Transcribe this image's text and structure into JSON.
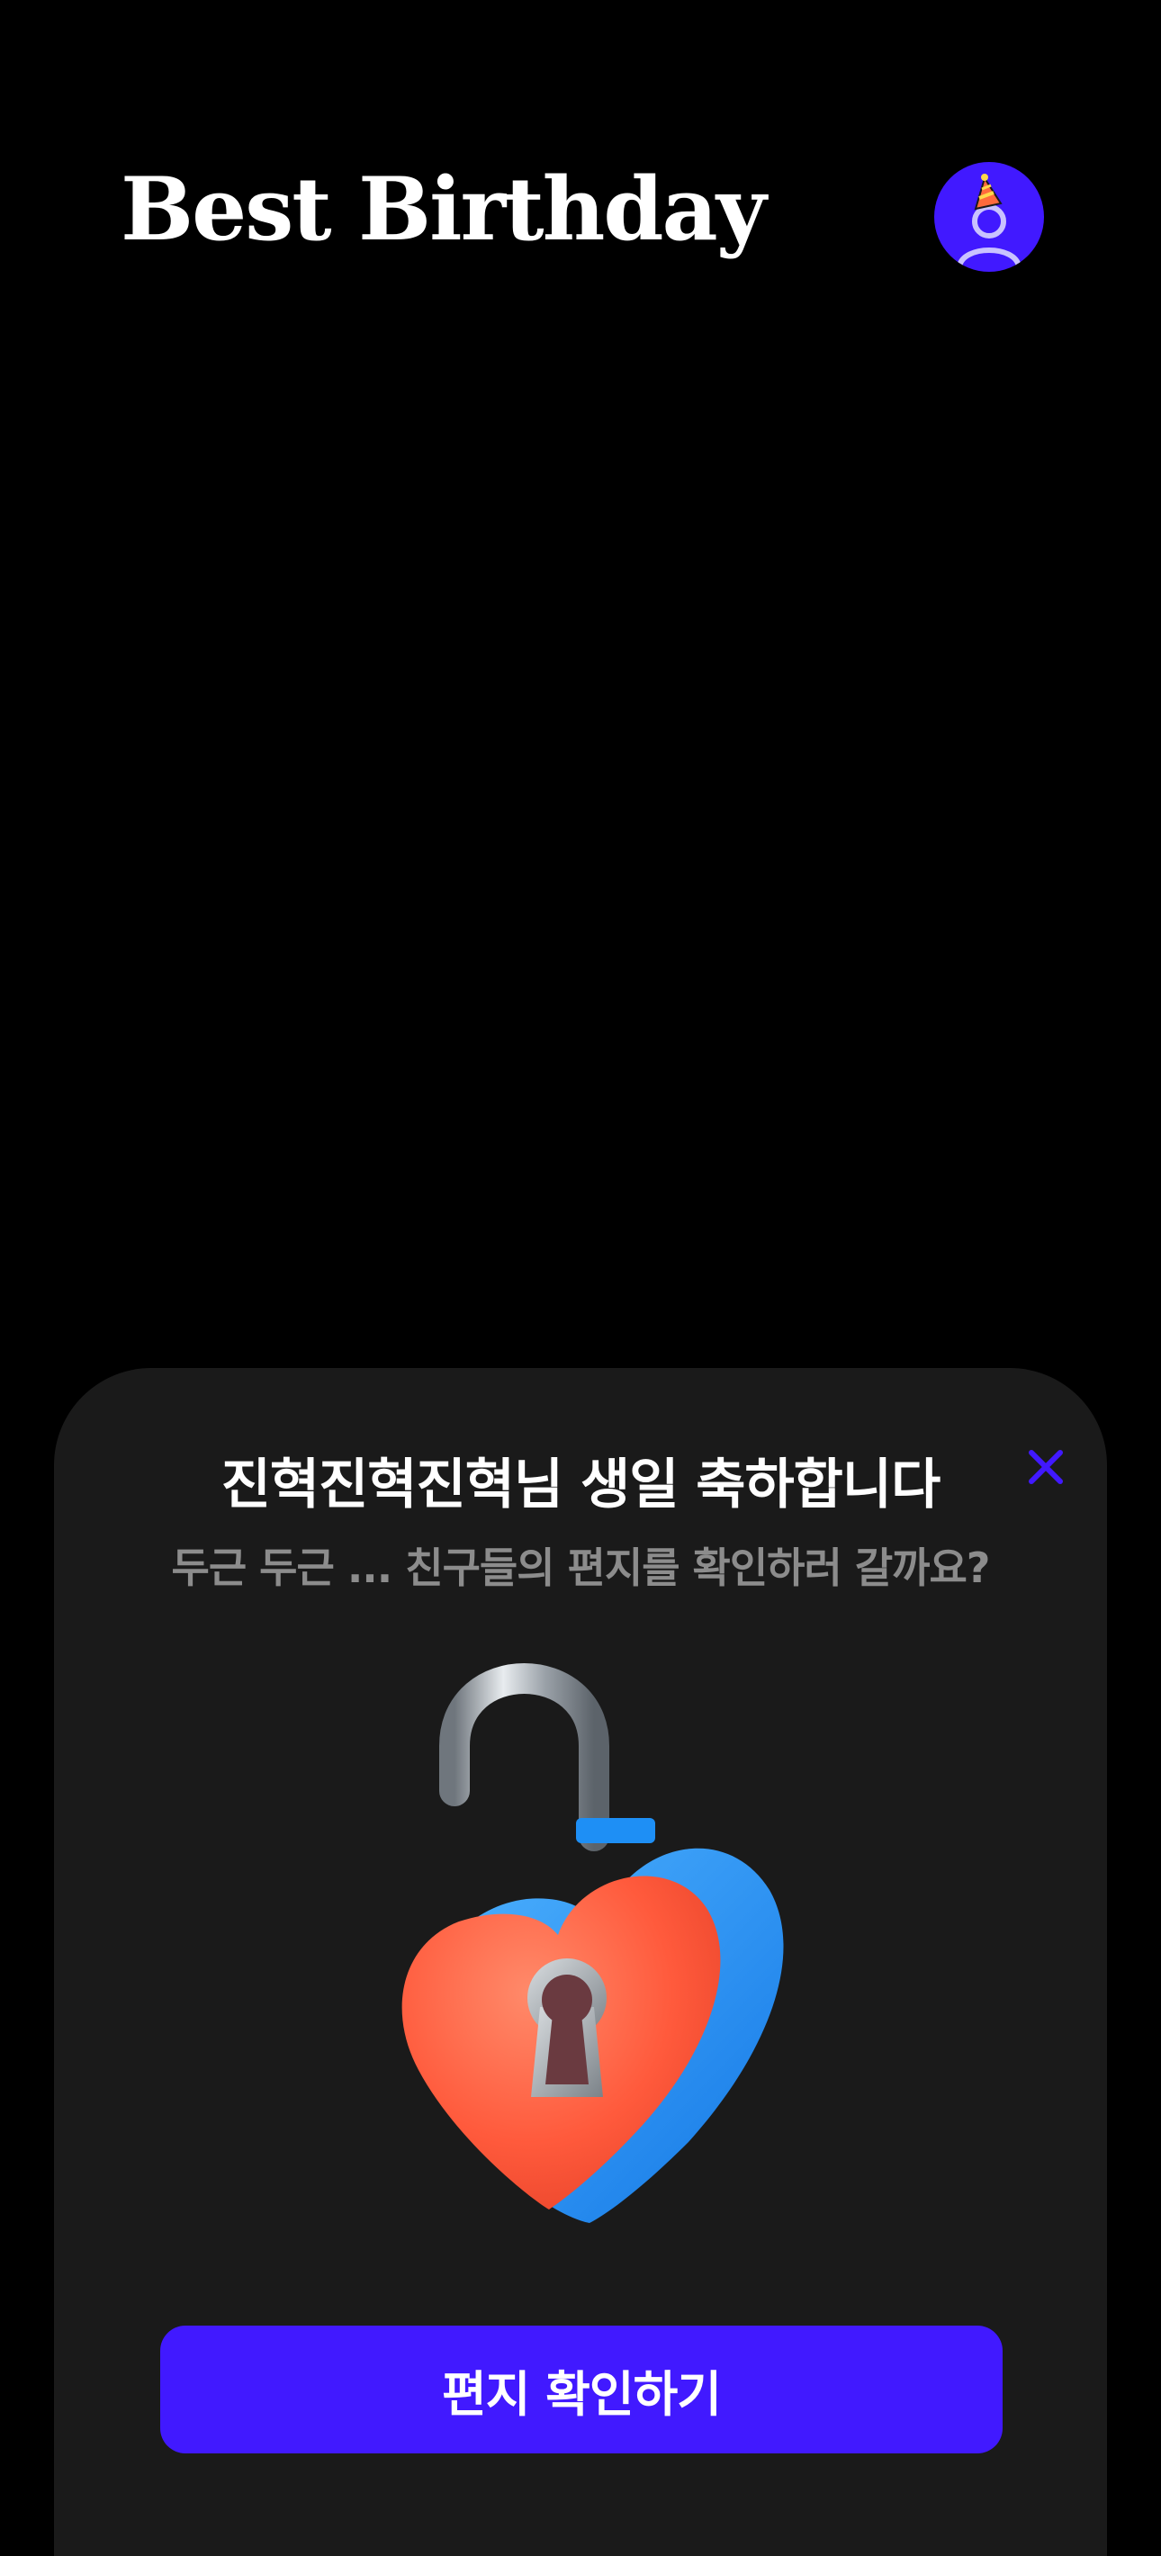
{
  "header": {
    "app_title": "Best Birthday",
    "avatar_icon": "birthday-party-hat-user-icon"
  },
  "modal": {
    "title": "진혁진혁진혁님 생일 축하합니다",
    "subtitle": "두근 두근 ... 친구들의 편지를 확인하러 갈까요?",
    "close_icon": "close-icon",
    "illustration": "heart-padlock-unlocked",
    "button_label": "편지 확인하기"
  },
  "colors": {
    "background": "#000000",
    "sheet": "#1a1a1a",
    "accent": "#4119ff",
    "title_text": "#ffffff",
    "subtitle_text": "#8c8c8c",
    "heart": "#ff5a3c",
    "lock_body": "#1e90ff"
  }
}
